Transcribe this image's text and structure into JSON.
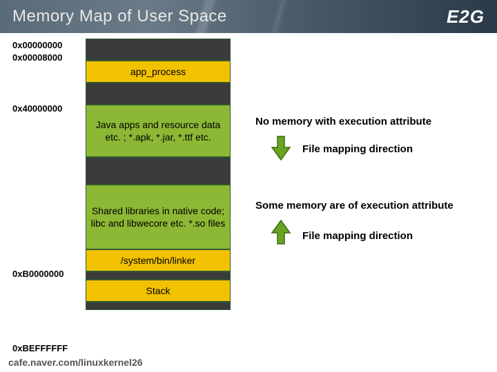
{
  "header": {
    "title": "Memory Map of User Space",
    "logo": "E2G"
  },
  "addresses": {
    "a0": "0x00000000",
    "a1": "0x00008000",
    "a2": "0x40000000",
    "a3": "0xB0000000",
    "a4": "0xBEFFFFFF"
  },
  "blocks": {
    "app_process": "app_process",
    "java_apps": "Java apps and resource data etc. ; *.apk, *.jar, *.ttf etc.",
    "shared_libs": "Shared libraries in native code;\nlibc and libwecore etc. *.so files",
    "linker": "/system/bin/linker",
    "stack": "Stack"
  },
  "annotations": {
    "no_exec": "No memory with execution attribute",
    "fmap1": "File mapping direction",
    "some_exec": "Some memory are of execution attribute",
    "fmap2": "File mapping direction"
  },
  "footer": "cafe.naver.com/linuxkernel26",
  "colors": {
    "arrow_fill": "#6aa321",
    "arrow_stroke": "#3d6b12"
  }
}
